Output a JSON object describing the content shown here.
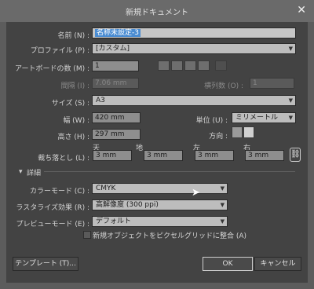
{
  "window": {
    "title": "新規ドキュメント",
    "close_glyph": "✕"
  },
  "name": {
    "label": "名前 (N) :",
    "value": "名称未設定-3"
  },
  "profile": {
    "label": "プロファイル (P) :",
    "value": "[カスタム]"
  },
  "artboards": {
    "label": "アートボードの数 (M) :",
    "value": "1"
  },
  "spacing": {
    "label": "間隔 (I) :",
    "value": "7.06 mm"
  },
  "columns": {
    "label": "横列数 (O) :",
    "value": "1"
  },
  "size": {
    "label": "サイズ (S) :",
    "value": "A3"
  },
  "width": {
    "label": "幅 (W) :",
    "value": "420 mm"
  },
  "units": {
    "label": "単位 (U) :",
    "value": "ミリメートル"
  },
  "height": {
    "label": "高さ (H) :",
    "value": "297 mm"
  },
  "orientation": {
    "label": "方向 :"
  },
  "bleed": {
    "label": "裁ち落とし (L) :",
    "top_label": "天",
    "top": "3 mm",
    "bottom_label": "地",
    "bottom": "3 mm",
    "left_label": "左",
    "left": "3 mm",
    "right_label": "右",
    "right": "3 mm"
  },
  "advanced": {
    "label": "詳細"
  },
  "color_mode": {
    "label": "カラーモード (C) :",
    "value": "CMYK"
  },
  "raster": {
    "label": "ラスタライズ効果 (R) :",
    "value": "高解像度 (300 ppi)"
  },
  "preview": {
    "label": "プレビューモード (E) :",
    "value": "デフォルト"
  },
  "align_pixel": {
    "label": "新規オブジェクトをピクセルグリッドに整合 (A)"
  },
  "buttons": {
    "templates": "テンプレート (T)...",
    "ok": "OK",
    "cancel": "キャンセル"
  }
}
